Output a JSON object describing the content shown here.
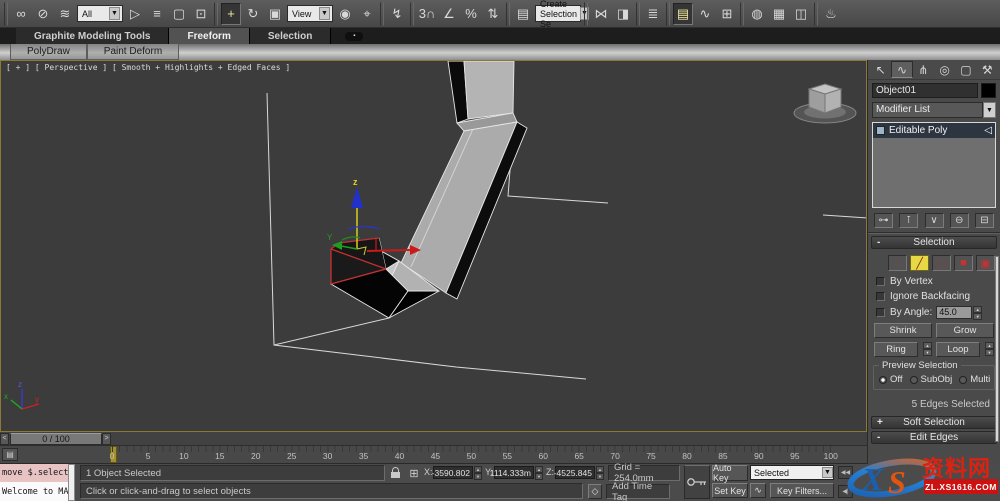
{
  "toolbar": {
    "items": [
      {
        "kind": "sep",
        "name": "toolbar-separator"
      },
      {
        "kind": "icon",
        "name": "select-and-link-icon",
        "glyph": "∞"
      },
      {
        "kind": "icon",
        "name": "unlink-selection-icon",
        "glyph": "⊘"
      },
      {
        "kind": "icon",
        "name": "bind-to-space-warp-icon",
        "glyph": "≋"
      },
      {
        "kind": "dropdown",
        "name": "selection-filter-dropdown",
        "label": "All"
      },
      {
        "kind": "icon",
        "name": "select-object-icon",
        "glyph": "▷"
      },
      {
        "kind": "icon",
        "name": "select-by-name-icon",
        "glyph": "≡"
      },
      {
        "kind": "icon",
        "name": "rectangular-selection-region-icon",
        "glyph": "▢"
      },
      {
        "kind": "icon",
        "name": "window-crossing-toggle-icon",
        "glyph": "⊡"
      },
      {
        "kind": "sep",
        "name": "toolbar-separator"
      },
      {
        "kind": "icon",
        "name": "select-and-move-icon",
        "glyph": "+",
        "active": true
      },
      {
        "kind": "icon",
        "name": "select-and-rotate-icon",
        "glyph": "↻"
      },
      {
        "kind": "icon",
        "name": "select-and-scale-icon",
        "glyph": "▣"
      },
      {
        "kind": "dropdown",
        "name": "reference-coordinate-system-dropdown",
        "label": "View"
      },
      {
        "kind": "icon",
        "name": "use-pivot-point-center-icon",
        "glyph": "◉"
      },
      {
        "kind": "icon",
        "name": "select-and-manipulate-icon",
        "glyph": "⌖"
      },
      {
        "kind": "sep",
        "name": "toolbar-separator"
      },
      {
        "kind": "icon",
        "name": "keyboard-shortcut-override-icon",
        "glyph": "↯"
      },
      {
        "kind": "sep",
        "name": "toolbar-separator"
      },
      {
        "kind": "icon",
        "name": "snaps-toggle-icon",
        "glyph": "3∩"
      },
      {
        "kind": "icon",
        "name": "angle-snap-icon",
        "glyph": "∠"
      },
      {
        "kind": "icon",
        "name": "percent-snap-icon",
        "glyph": "%"
      },
      {
        "kind": "icon",
        "name": "spinner-snap-icon",
        "glyph": "⇅"
      },
      {
        "kind": "sep",
        "name": "toolbar-separator"
      },
      {
        "kind": "icon",
        "name": "edit-named-selection-sets-icon",
        "glyph": "▤"
      },
      {
        "kind": "dropdown",
        "name": "named-selection-sets-dropdown",
        "label": "Create Selection Se"
      },
      {
        "kind": "sep",
        "name": "toolbar-separator"
      },
      {
        "kind": "icon",
        "name": "mirror-icon",
        "glyph": "⋈"
      },
      {
        "kind": "icon",
        "name": "align-icon",
        "glyph": "◨"
      },
      {
        "kind": "sep",
        "name": "toolbar-separator"
      },
      {
        "kind": "icon",
        "name": "manage-layers-icon",
        "glyph": "≣"
      },
      {
        "kind": "sep",
        "name": "toolbar-separator"
      },
      {
        "kind": "icon",
        "name": "graphite-modeling-tools-toggle-icon",
        "glyph": "▤",
        "active": true
      },
      {
        "kind": "icon",
        "name": "curve-editor-icon",
        "glyph": "∿"
      },
      {
        "kind": "icon",
        "name": "schematic-view-icon",
        "glyph": "⊞"
      },
      {
        "kind": "sep",
        "name": "toolbar-separator"
      },
      {
        "kind": "icon",
        "name": "material-editor-icon",
        "glyph": "◍"
      },
      {
        "kind": "icon",
        "name": "render-setup-icon",
        "glyph": "▦"
      },
      {
        "kind": "icon",
        "name": "rendered-frame-window-icon",
        "glyph": "◫"
      },
      {
        "kind": "sep",
        "name": "toolbar-separator"
      },
      {
        "kind": "icon",
        "name": "render-production-icon",
        "glyph": "♨"
      }
    ]
  },
  "ribbon": {
    "tabs": [
      {
        "name": "ribbon-tab-graphite-modeling-tools",
        "label": "Graphite Modeling Tools"
      },
      {
        "name": "ribbon-tab-freeform",
        "label": "Freeform",
        "active": true
      },
      {
        "name": "ribbon-tab-selection",
        "label": "Selection"
      }
    ],
    "subtabs": [
      {
        "name": "ribbon-subtab-polydraw",
        "label": "PolyDraw"
      },
      {
        "name": "ribbon-subtab-paint-deform",
        "label": "Paint Deform"
      }
    ]
  },
  "viewport": {
    "label": "[ + ] [ Perspective ] [ Smooth + Highlights + Edged Faces ]",
    "gizmo": {
      "z_label": "z",
      "y_label": "Y"
    },
    "tripod": {
      "x_label": "x",
      "y_label": "y",
      "z_label": "z"
    }
  },
  "command_panel": {
    "tabs": [
      {
        "name": "command-tab-create",
        "glyph": "↖"
      },
      {
        "name": "command-tab-modify",
        "glyph": "∿",
        "active": true
      },
      {
        "name": "command-tab-hierarchy",
        "glyph": "⋔"
      },
      {
        "name": "command-tab-motion",
        "glyph": "◎"
      },
      {
        "name": "command-tab-display",
        "glyph": "▢"
      },
      {
        "name": "command-tab-utilities",
        "glyph": "⚒"
      }
    ],
    "object_name": "Object01",
    "modifier_list_label": "Modifier List",
    "stack_row": "Editable Poly",
    "stack_buttons": [
      {
        "name": "pin-stack-button",
        "glyph": "⊶"
      },
      {
        "name": "show-end-result-button",
        "glyph": "⊺"
      },
      {
        "name": "make-unique-button",
        "glyph": "∨"
      },
      {
        "name": "remove-modifier-button",
        "glyph": "⊖"
      },
      {
        "name": "configure-modifier-sets-button",
        "glyph": "⊟"
      }
    ],
    "selection_rollout": {
      "state": "-",
      "title": "Selection",
      "subobject_buttons": [
        {
          "name": "vertex-mode-button",
          "glyph": "∴",
          "tone": "dim"
        },
        {
          "name": "edge-mode-button",
          "glyph": "╱",
          "active": true
        },
        {
          "name": "border-mode-button",
          "glyph": "▢",
          "tone": "dim"
        },
        {
          "name": "polygon-mode-button",
          "glyph": "■",
          "tone": "bright"
        },
        {
          "name": "element-mode-button",
          "glyph": "▣",
          "tone": "bright"
        }
      ],
      "checkboxes": [
        {
          "name": "by-vertex-checkbox",
          "label": "By Vertex"
        },
        {
          "name": "ignore-backfacing-checkbox",
          "label": "Ignore Backfacing"
        }
      ],
      "by_angle": {
        "label": "By Angle:",
        "value": "45.0"
      },
      "shrink": "Shrink",
      "grow": "Grow",
      "ring": "Ring",
      "loop": "Loop",
      "preview_selection": {
        "title": "Preview Selection",
        "options": [
          {
            "name": "preview-off-radio",
            "label": "Off",
            "active": true
          },
          {
            "name": "preview-subobj-radio",
            "label": "SubObj"
          },
          {
            "name": "preview-multi-radio",
            "label": "Multi"
          }
        ]
      },
      "status": "5 Edges Selected"
    },
    "bottom_rollouts": [
      {
        "name": "rollout-soft-selection",
        "state": "+",
        "title": "Soft Selection"
      },
      {
        "name": "rollout-edit-edges",
        "state": "-",
        "title": "Edit Edges"
      }
    ]
  },
  "timeline": {
    "prev": "<",
    "next": ">",
    "slider_value": "0 / 100",
    "frame_labels": [
      "0",
      "5",
      "10",
      "15",
      "20",
      "25",
      "30",
      "35",
      "40",
      "45",
      "50",
      "55",
      "60",
      "65",
      "70",
      "75",
      "80",
      "85",
      "90",
      "95",
      "100"
    ]
  },
  "status_bar": {
    "listener_line1": "move $.selecte",
    "listener_line2": "Welcome to MAX",
    "status": "1 Object Selected",
    "prompt": "Click or click-and-drag to select objects",
    "x_label": "X:",
    "x_value": "-3590.802",
    "y_label": "Y:",
    "y_value": "1114.333m",
    "z_label": "Z:",
    "z_value": "-4525.845",
    "grid": "Grid = 254.0mm",
    "add_time_tag": "Add Time Tag",
    "auto_key": "Auto Key",
    "set_key": "Set Key",
    "selected_dropdown": "Selected",
    "key_filters": "Key Filters...",
    "tangent_icon_glyph": "∿",
    "adaptive_glyph": "◇"
  },
  "watermark": {
    "logo_x": "X",
    "logo_s": "S",
    "site_name": "资料网",
    "site_url": "ZL.XS1616.COM"
  }
}
